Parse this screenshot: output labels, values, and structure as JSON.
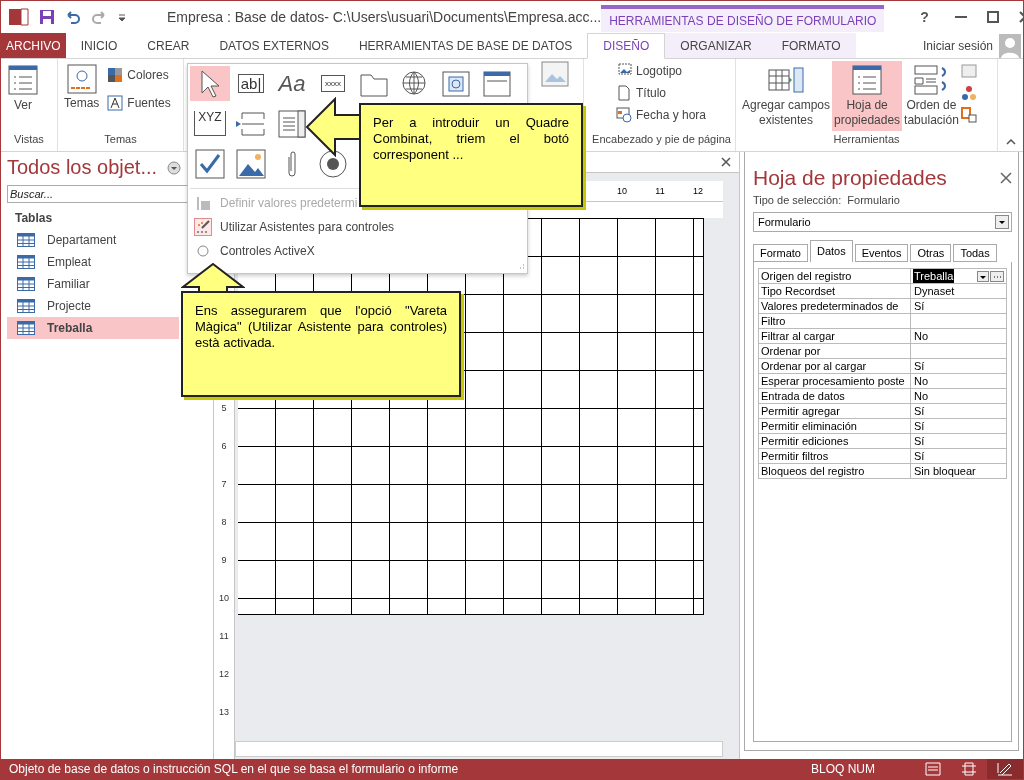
{
  "title_bar": {
    "title": "Empresa : Base de datos- C:\\Users\\usuari\\Documents\\Empresa.acc...",
    "contextual_group": "HERRAMIENTAS DE DISEÑO DE FORMULARIO",
    "help": "?"
  },
  "tabs": [
    {
      "label": "ARCHIVO",
      "kind": "file",
      "selected": false
    },
    {
      "label": "INICIO",
      "kind": "plain",
      "selected": false
    },
    {
      "label": "CREAR",
      "kind": "plain",
      "selected": false
    },
    {
      "label": "DATOS EXTERNOS",
      "kind": "plain",
      "selected": false
    },
    {
      "label": "HERRAMIENTAS DE BASE DE DATOS",
      "kind": "plain",
      "selected": false
    },
    {
      "label": "DISEÑO",
      "kind": "contextual",
      "selected": true
    },
    {
      "label": "ORGANIZAR",
      "kind": "contextual",
      "selected": false
    },
    {
      "label": "FORMATO",
      "kind": "contextual",
      "selected": false
    }
  ],
  "account": {
    "label": "Iniciar sesión"
  },
  "ribbon": {
    "vistas": {
      "label": "Vistas",
      "button": "Ver"
    },
    "temas": {
      "label": "Temas",
      "button": "Temas",
      "colors": "Colores",
      "fonts": "Fuentes"
    },
    "header_footer": {
      "label": "Encabezado y pie de página",
      "items": [
        {
          "kind": "logo",
          "label": "Logotipo"
        },
        {
          "kind": "title",
          "label": "Título"
        },
        {
          "kind": "date",
          "label": "Fecha y hora"
        }
      ]
    },
    "tools": {
      "label": "Herramientas",
      "buttons": [
        {
          "kind": "fields",
          "lines": [
            "Agregar campos",
            "existentes"
          ],
          "selected": false
        },
        {
          "kind": "sheet",
          "lines": [
            "Hoja de",
            "propiedades"
          ],
          "selected": true
        },
        {
          "kind": "taborder",
          "lines": [
            "Orden de",
            "tabulación"
          ],
          "selected": false
        }
      ]
    }
  },
  "controls_menu": {
    "gallery": [
      [
        {
          "kind": "pointer",
          "selected": true
        },
        {
          "kind": "textbox",
          "glyph": "ab|",
          "selected": false
        },
        {
          "kind": "label",
          "glyph": "Aa",
          "selected": false
        },
        {
          "kind": "button",
          "glyph": "xxxx",
          "selected": false
        },
        {
          "kind": "tab",
          "selected": false
        },
        {
          "kind": "hyperlink",
          "selected": false
        },
        {
          "kind": "browser",
          "selected": false
        },
        {
          "kind": "navigation",
          "selected": false
        }
      ],
      [
        {
          "kind": "group",
          "glyph": "XYZ",
          "selected": false
        },
        {
          "kind": "pagebreak",
          "selected": false
        },
        {
          "kind": "combo",
          "selected": false
        }
      ],
      [
        {
          "kind": "checkbox",
          "selected": false
        },
        {
          "kind": "image",
          "selected": false
        },
        {
          "kind": "attachment",
          "selected": false
        },
        {
          "kind": "radio",
          "selected": false
        }
      ]
    ],
    "items": [
      {
        "kind": "defaults",
        "label": "Definir valores predetermi",
        "disabled": true,
        "checked": false
      },
      {
        "kind": "wizard",
        "label": "Utilizar Asistentes para controles",
        "disabled": false,
        "checked": true
      },
      {
        "kind": "activex",
        "label": "Controles ActiveX",
        "disabled": false,
        "checked": false
      }
    ]
  },
  "callouts": [
    {
      "text": "Per a introduir un Quadre Combinat, triem el botó corresponent ..."
    },
    {
      "text": "Ens assegurarem que l'opció \"Vareta Màgica\" (Utilizar Asistente para controles) està activada."
    }
  ],
  "navigation": {
    "title": "Todos los objet...",
    "search": {
      "placeholder": "Buscar..."
    },
    "groups": [
      {
        "label": "Tablas",
        "items": [
          {
            "label": "Departament",
            "selected": false
          },
          {
            "label": "Empleat",
            "selected": false
          },
          {
            "label": "Familiar",
            "selected": false
          },
          {
            "label": "Projecte",
            "selected": false
          },
          {
            "label": "Treballa",
            "selected": true
          }
        ]
      }
    ]
  },
  "designer": {
    "top_ruler": [
      "10",
      "11",
      "12"
    ],
    "left_ruler": [
      "5",
      "6",
      "7",
      "8",
      "9",
      "10",
      "11",
      "12",
      "13"
    ]
  },
  "property_sheet": {
    "title": "Hoja de propiedades",
    "selection_label": "Tipo de selección:",
    "selection_type": "Formulario",
    "object": "Formulario",
    "tabs": [
      {
        "label": "Formato",
        "selected": false
      },
      {
        "label": "Datos",
        "selected": true
      },
      {
        "label": "Eventos",
        "selected": false
      },
      {
        "label": "Otras",
        "selected": false
      },
      {
        "label": "Todas",
        "selected": false
      }
    ],
    "rows": [
      {
        "name": "Origen del registro",
        "value": "Treballa",
        "selected": true
      },
      {
        "name": "Tipo Recordset",
        "value": "Dynaset",
        "selected": false
      },
      {
        "name": "Valores predeterminados de",
        "value": "Sí",
        "selected": false
      },
      {
        "name": "Filtro",
        "selected": false
      },
      {
        "name": "Filtrar al cargar",
        "value": "No",
        "selected": false
      },
      {
        "name": "Ordenar por",
        "selected": false
      },
      {
        "name": "Ordenar por al cargar",
        "value": "Sí",
        "selected": false
      },
      {
        "name": "Esperar procesamiento poste",
        "value": "No",
        "selected": false
      },
      {
        "name": "Entrada de datos",
        "value": "No",
        "selected": false
      },
      {
        "name": "Permitir agregar",
        "value": "Sí",
        "selected": false
      },
      {
        "name": "Permitir eliminación",
        "value": "Sí",
        "selected": false
      },
      {
        "name": "Permitir ediciones",
        "value": "Sí",
        "selected": false
      },
      {
        "name": "Permitir filtros",
        "value": "Sí",
        "selected": false
      },
      {
        "name": "Bloqueos del registro",
        "value": "Sin bloquear",
        "selected": false
      }
    ]
  },
  "status_bar": {
    "message": "Objeto de base de datos o instrucción SQL en el que se basa el formulario o informe",
    "indicator": "BLOQ NUM",
    "views": [
      {
        "kind": "form",
        "selected": false
      },
      {
        "kind": "layout",
        "selected": false
      },
      {
        "kind": "design",
        "selected": true
      }
    ]
  }
}
